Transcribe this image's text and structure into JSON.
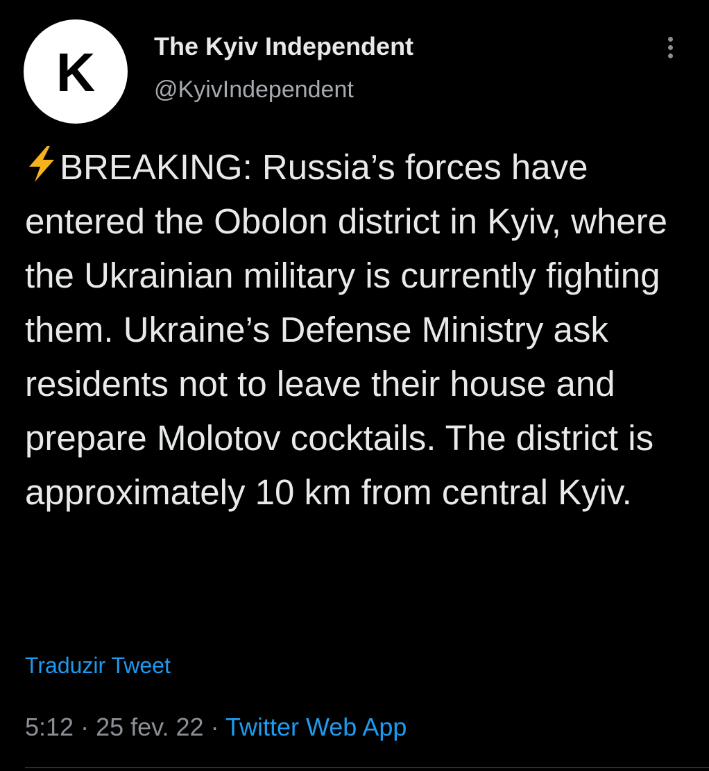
{
  "author": {
    "avatar_letter": "K",
    "display_name": "The Kyiv Independent",
    "handle": "@KyivIndependent"
  },
  "tweet": {
    "emoji_icon": "high-voltage-bolt",
    "text": "BREAKING: Russia’s forces have entered the Obolon district in Kyiv, where the Ukrainian military is currently fighting them. Ukraine’s Defense Ministry ask residents not to leave their house and prepare Molotov cocktails. The district is approximately 10 km from central Kyiv.",
    "translate_label": "Traduzir Tweet"
  },
  "meta": {
    "time": "5:12",
    "separator": "·",
    "date": "25 fev. 22",
    "source": "Twitter Web App"
  },
  "colors": {
    "background": "#000000",
    "text": "#e7e9ea",
    "secondary": "#8b9096",
    "link": "#1d9bf0",
    "bolt": "#f5b21b"
  }
}
